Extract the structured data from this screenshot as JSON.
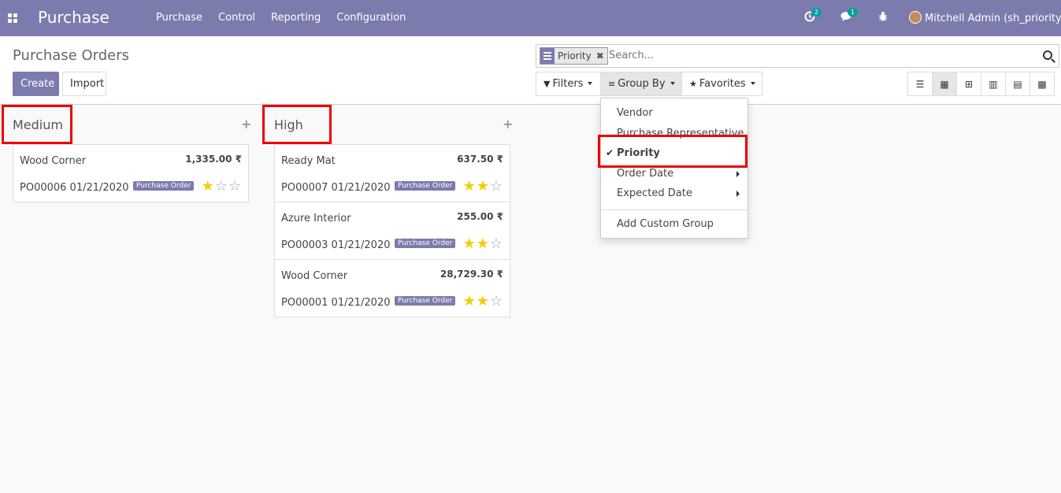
{
  "navbar": {
    "brand": "Purchase",
    "menu": [
      "Purchase",
      "Control",
      "Reporting",
      "Configuration"
    ],
    "activity_count": "2",
    "messages_count": "1",
    "user": "Mitchell Admin (sh_priority)"
  },
  "control": {
    "title": "Purchase Orders",
    "create_label": "Create",
    "import_label": "Import",
    "facet_label": "Priority",
    "search_placeholder": "Search...",
    "filters_label": "Filters",
    "groupby_label": "Group By",
    "favorites_label": "Favorites"
  },
  "groupby_menu": {
    "items": [
      "Vendor",
      "Purchase Representative",
      "Priority",
      "Order Date",
      "Expected Date"
    ],
    "checked": "Priority",
    "add_custom": "Add Custom Group"
  },
  "columns": [
    {
      "title": "Medium",
      "cards": [
        {
          "partner": "Wood Corner",
          "amount": "1,335.00 ₹",
          "ref": "PO00006 01/21/2020",
          "tag": "Purchase Order",
          "stars": 1
        }
      ]
    },
    {
      "title": "High",
      "cards": [
        {
          "partner": "Ready Mat",
          "amount": "637.50 ₹",
          "ref": "PO00007 01/21/2020",
          "tag": "Purchase Order",
          "stars": 2
        },
        {
          "partner": "Azure Interior",
          "amount": "255.00 ₹",
          "ref": "PO00003 01/21/2020",
          "tag": "Purchase Order",
          "stars": 2
        },
        {
          "partner": "Wood Corner",
          "amount": "28,729.30 ₹",
          "ref": "PO00001 01/21/2020",
          "tag": "Purchase Order",
          "stars": 2
        }
      ]
    }
  ],
  "colors": {
    "brand": "#7c7bad",
    "star": "#f3cc00",
    "highlight": "#e00000"
  }
}
